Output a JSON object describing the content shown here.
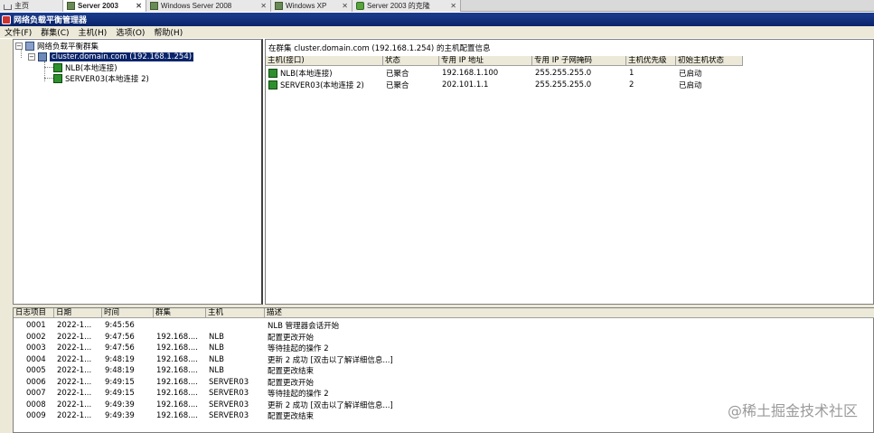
{
  "vm_tabs": [
    {
      "label": "主页",
      "icon": "home-icon",
      "closable": false,
      "active": false
    },
    {
      "label": "Server 2003",
      "icon": "vm-icon",
      "closable": true,
      "active": true
    },
    {
      "label": "Windows Server 2008",
      "icon": "vm-icon",
      "closable": true,
      "active": false
    },
    {
      "label": "Windows XP",
      "icon": "vm-icon",
      "closable": true,
      "active": false
    },
    {
      "label": "Server 2003 的克隆",
      "icon": "vm-running-icon",
      "closable": true,
      "active": false
    }
  ],
  "close_glyph": "✕",
  "app": {
    "title": "网络负载平衡管理器"
  },
  "menu": [
    "文件(F)",
    "群集(C)",
    "主机(H)",
    "选项(O)",
    "帮助(H)"
  ],
  "tree": {
    "root": "网络负载平衡群集",
    "cluster": "cluster.domain.com (192.168.1.254)",
    "hosts": [
      "NLB(本地连接)",
      "SERVER03(本地连接 2)"
    ],
    "expander_open": "−"
  },
  "cluster_view": {
    "caption": "在群集 cluster.domain.com (192.168.1.254) 的主机配置信息",
    "columns": [
      "主机(接口)",
      "状态",
      "专用 IP 地址",
      "专用 IP 子网掩码",
      "主机优先级",
      "初始主机状态"
    ],
    "rows": [
      [
        "NLB(本地连接)",
        "已聚合",
        "192.168.1.100",
        "255.255.255.0",
        "1",
        "已启动"
      ],
      [
        "SERVER03(本地连接 2)",
        "已聚合",
        "202.101.1.1",
        "255.255.255.0",
        "2",
        "已启动"
      ]
    ]
  },
  "log": {
    "columns": [
      "日志项目",
      "日期",
      "时间",
      "群集",
      "主机",
      "描述"
    ],
    "rows": [
      [
        "0001",
        "2022-1...",
        "9:45:56",
        "",
        "",
        "NLB 管理器会话开始"
      ],
      [
        "0002",
        "2022-1...",
        "9:47:56",
        "192.168....",
        "NLB",
        "配置更改开始"
      ],
      [
        "0003",
        "2022-1...",
        "9:47:56",
        "192.168....",
        "NLB",
        "等待挂起的操作 2"
      ],
      [
        "0004",
        "2022-1...",
        "9:48:19",
        "192.168....",
        "NLB",
        "更新 2 成功 [双击以了解详细信息...]"
      ],
      [
        "0005",
        "2022-1...",
        "9:48:19",
        "192.168....",
        "NLB",
        "配置更改结束"
      ],
      [
        "0006",
        "2022-1...",
        "9:49:15",
        "192.168....",
        "SERVER03",
        "配置更改开始"
      ],
      [
        "0007",
        "2022-1...",
        "9:49:15",
        "192.168....",
        "SERVER03",
        "等待挂起的操作 2"
      ],
      [
        "0008",
        "2022-1...",
        "9:49:39",
        "192.168....",
        "SERVER03",
        "更新 2 成功 [双击以了解详细信息...]"
      ],
      [
        "0009",
        "2022-1...",
        "9:49:39",
        "192.168....",
        "SERVER03",
        "配置更改结束"
      ]
    ]
  },
  "watermark": "@稀土掘金技术社区"
}
